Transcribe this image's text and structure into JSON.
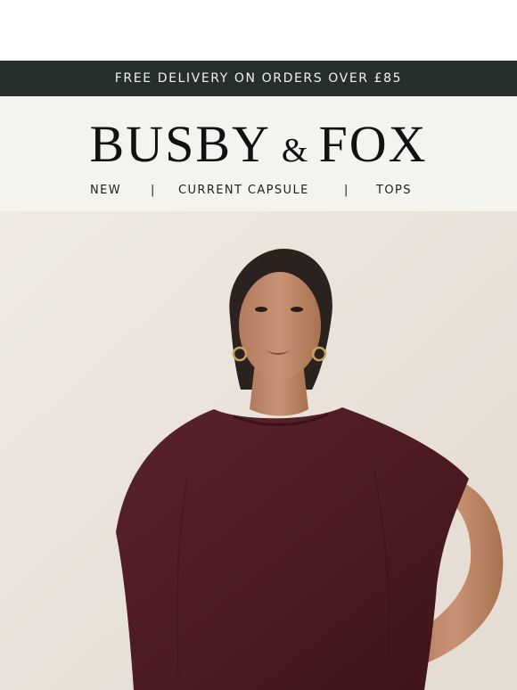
{
  "promo": {
    "text": "FREE DELIVERY ON ORDERS OVER £85"
  },
  "brand": {
    "logo_word1": "BUSBY",
    "logo_amp": "&",
    "logo_word2": "FOX",
    "logo_alt": "BUSBY & FOX"
  },
  "nav": {
    "items": [
      "NEW",
      "CURRENT CAPSULE",
      "TOPS"
    ],
    "separator": "|"
  },
  "hero": {
    "image_alt": "Model wearing a burgundy batwing knitted top"
  },
  "colors": {
    "promo_background": "#272e2e",
    "header_background": "#f4f3ef",
    "hero_backdrop": "#ece6de",
    "top_color": "#4e1c23"
  }
}
